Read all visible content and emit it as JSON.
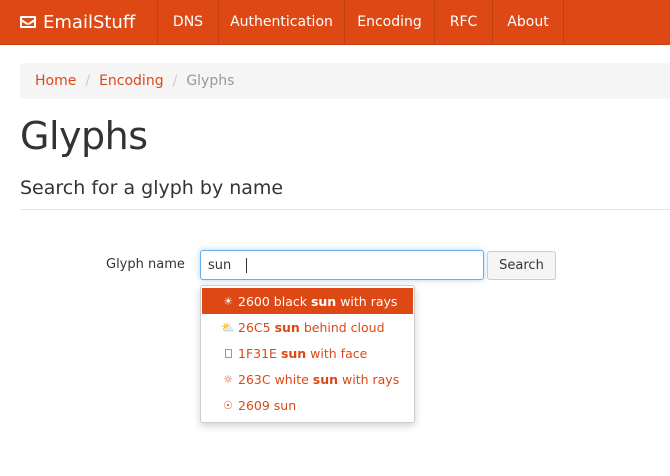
{
  "navbar": {
    "brand": "EmailStuff",
    "brand_icon": "envelope-icon",
    "items": [
      {
        "label": "DNS"
      },
      {
        "label": "Authentication"
      },
      {
        "label": "Encoding"
      },
      {
        "label": "RFC"
      },
      {
        "label": "About"
      }
    ],
    "color": "#dd4814"
  },
  "breadcrumb": {
    "items": [
      {
        "label": "Home"
      },
      {
        "label": "Encoding"
      },
      {
        "label": "Glyphs"
      }
    ]
  },
  "page": {
    "title": "Glyphs",
    "subtitle": "Search for a glyph by name"
  },
  "search": {
    "label": "Glyph name",
    "value": "sun ",
    "button": "Search"
  },
  "suggestions": [
    {
      "glyph": "☀",
      "code": "2600",
      "before": "black",
      "match": "sun",
      "after": "with rays",
      "active": true
    },
    {
      "glyph": "⛅",
      "code": "26C5",
      "before": "",
      "match": "sun",
      "after": "behind cloud",
      "active": false
    },
    {
      "glyph": "",
      "code": "1F31E",
      "before": "",
      "match": "sun",
      "after": "with face",
      "active": false
    },
    {
      "glyph": "☼",
      "code": "263C",
      "before": "white",
      "match": "sun",
      "after": "with rays",
      "active": false
    },
    {
      "glyph": "☉",
      "code": "2609",
      "before": "",
      "match": "sun",
      "after": "",
      "active": false
    }
  ]
}
